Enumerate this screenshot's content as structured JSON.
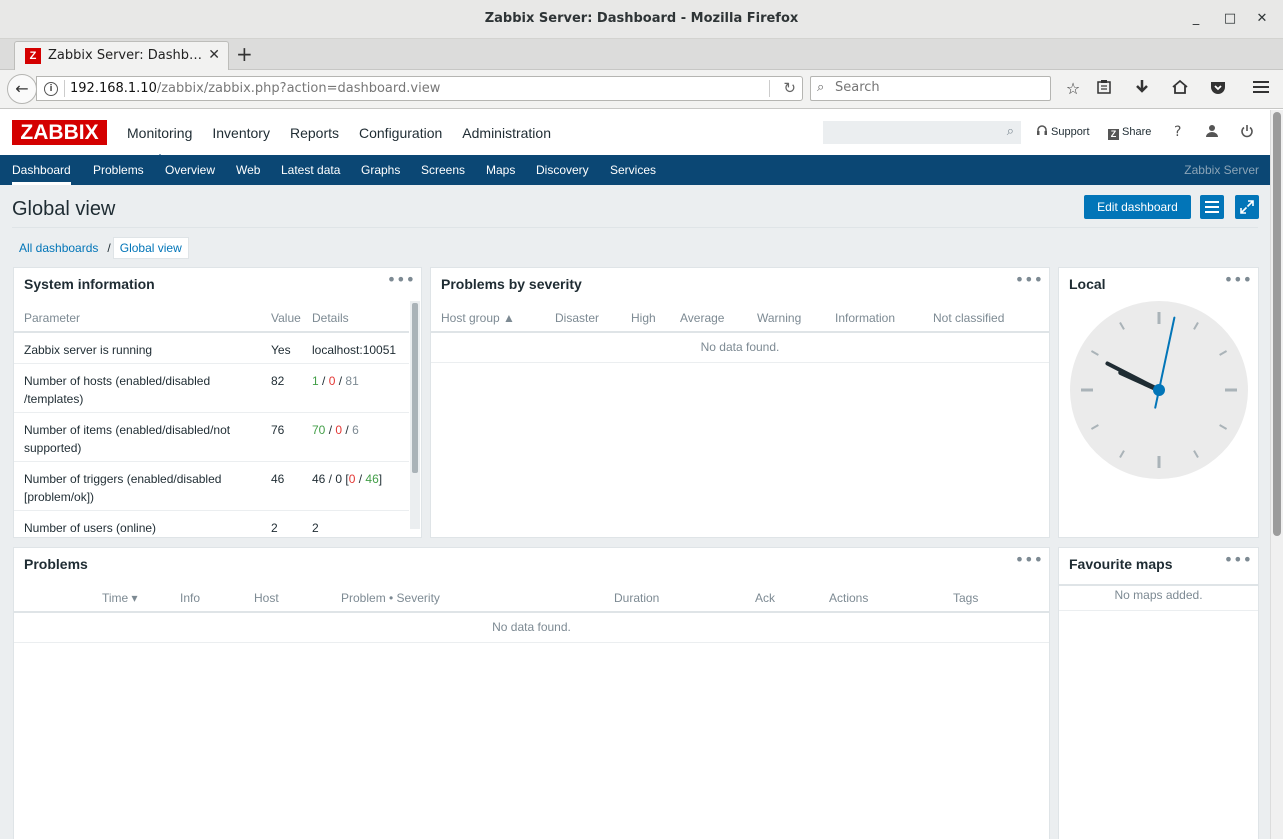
{
  "window": {
    "title": "Zabbix Server: Dashboard - Mozilla Firefox",
    "minimize": "_",
    "maximize": "□",
    "close": "✕"
  },
  "browser": {
    "tab_favicon": "Z",
    "tab_title": "Zabbix Server: Dashb…",
    "tab_close": "✕",
    "new_tab": "+",
    "url_host": "192.168.1.10",
    "url_path": "/zabbix/zabbix.php?action=dashboard.view",
    "search_placeholder": "Search",
    "icons": [
      "back-arrow-icon",
      "info-icon",
      "reload-icon",
      "search-icon",
      "star-icon",
      "reading-list-icon",
      "download-icon",
      "home-icon",
      "pocket-icon",
      "hamburger-menu-icon"
    ]
  },
  "header": {
    "logo": "ZABBIX",
    "menu": [
      "Monitoring",
      "Inventory",
      "Reports",
      "Configuration",
      "Administration"
    ],
    "active_menu": "Monitoring",
    "support": "Support",
    "share": "Share",
    "help": "?",
    "share_badge": "Z"
  },
  "submenu": {
    "items": [
      "Dashboard",
      "Problems",
      "Overview",
      "Web",
      "Latest data",
      "Graphs",
      "Screens",
      "Maps",
      "Discovery",
      "Services"
    ],
    "active": "Dashboard",
    "server_name": "Zabbix Server"
  },
  "page": {
    "title": "Global view",
    "edit_button": "Edit dashboard",
    "breadcrumbs": [
      "All dashboards",
      "Global view"
    ],
    "breadcrumb_sep": "/"
  },
  "system_info": {
    "title": "System information",
    "menu": "•••",
    "headers": [
      "Parameter",
      "Value",
      "Details"
    ],
    "rows": [
      {
        "parameter": "Zabbix server is running",
        "value": "Yes",
        "details": "localhost:10051"
      },
      {
        "parameter": "Number of hosts (enabled/disabled /templates)",
        "value": "82",
        "d1": "1",
        "d2": "0",
        "d3": "81"
      },
      {
        "parameter": "Number of items (enabled/disabled/not supported)",
        "value": "76",
        "d1": "70",
        "d2": "0",
        "d3": "6"
      },
      {
        "parameter": "Number of triggers (enabled/disabled [problem/ok])",
        "value": "46",
        "prefix": "46 / 0 [",
        "d2": "0",
        "d3": "46",
        "suffix": "]"
      },
      {
        "parameter": "Number of users (online)",
        "value": "2",
        "d1": "2"
      }
    ],
    "slash": " / "
  },
  "problems_by_severity": {
    "title": "Problems by severity",
    "menu": "•••",
    "headers": [
      "Host group ▲",
      "Disaster",
      "High",
      "Average",
      "Warning",
      "Information",
      "Not classified"
    ],
    "empty": "No data found."
  },
  "clock": {
    "title": "Local",
    "menu": "•••",
    "hours": 9,
    "minutes": 49,
    "seconds": 32
  },
  "problems": {
    "title": "Problems",
    "menu": "•••",
    "headers": [
      "Time ▾",
      "Info",
      "Host",
      "Problem • Severity",
      "Duration",
      "Ack",
      "Actions",
      "Tags"
    ],
    "empty": "No data found."
  },
  "favourite_maps": {
    "title": "Favourite maps",
    "menu": "•••",
    "empty": "No maps added."
  },
  "colors": {
    "brand_red": "#d40000",
    "nav_blue": "#0b4774",
    "button_blue": "#0275b8",
    "ok_green": "#429e47",
    "problem_red": "#e33734"
  }
}
